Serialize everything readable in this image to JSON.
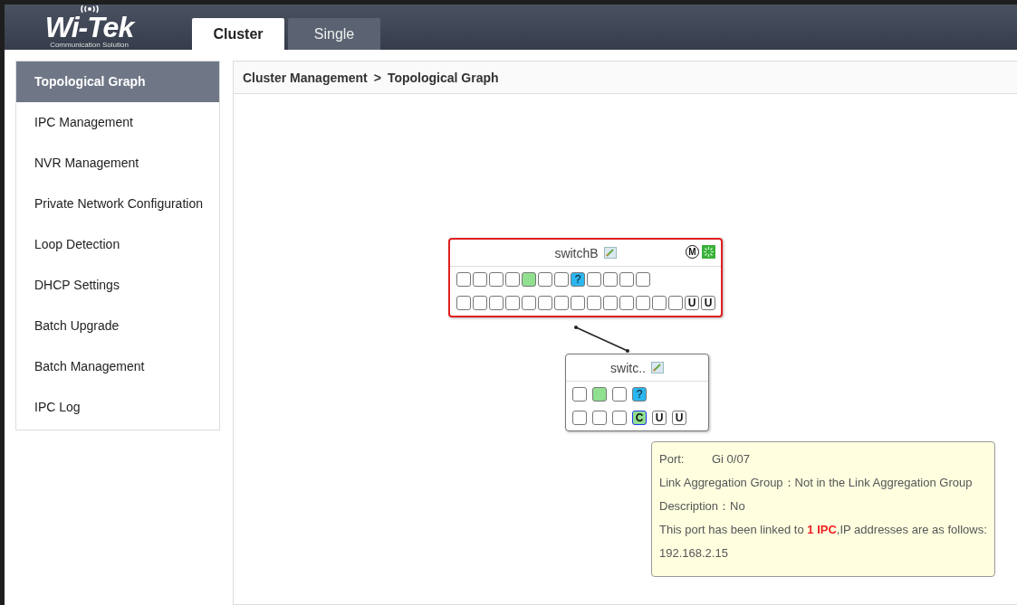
{
  "logo": {
    "name": "Wi-Tek",
    "tagline": "Communication Solution"
  },
  "tabs": [
    {
      "label": "Cluster",
      "selected": true
    },
    {
      "label": "Single",
      "selected": false
    }
  ],
  "sidebar": {
    "items": [
      {
        "label": "Topological Graph",
        "selected": true
      },
      {
        "label": "IPC Management",
        "selected": false
      },
      {
        "label": "NVR Management",
        "selected": false
      },
      {
        "label": "Private Network Configuration",
        "selected": false
      },
      {
        "label": "Loop Detection",
        "selected": false
      },
      {
        "label": "DHCP Settings",
        "selected": false
      },
      {
        "label": "Batch Upgrade",
        "selected": false
      },
      {
        "label": "Batch Management",
        "selected": false
      },
      {
        "label": "IPC Log",
        "selected": false
      }
    ]
  },
  "breadcrumb": {
    "parent": "Cluster Management",
    "separator": ">",
    "current": "Topological Graph"
  },
  "topology": {
    "nodes": [
      {
        "name": "switchB",
        "selected": true,
        "master": true,
        "badge": "M",
        "rows": [
          [
            {
              "kind": "empty"
            },
            {
              "kind": "empty"
            },
            {
              "kind": "empty"
            },
            {
              "kind": "empty"
            },
            {
              "kind": "up"
            },
            {
              "kind": "empty"
            },
            {
              "kind": "empty"
            },
            {
              "kind": "unknown",
              "label": "?"
            },
            {
              "kind": "empty"
            },
            {
              "kind": "empty"
            },
            {
              "kind": "empty"
            },
            {
              "kind": "empty"
            }
          ],
          [
            {
              "kind": "empty"
            },
            {
              "kind": "empty"
            },
            {
              "kind": "empty"
            },
            {
              "kind": "empty"
            },
            {
              "kind": "empty"
            },
            {
              "kind": "empty"
            },
            {
              "kind": "empty"
            },
            {
              "kind": "empty"
            },
            {
              "kind": "empty"
            },
            {
              "kind": "empty"
            },
            {
              "kind": "empty"
            },
            {
              "kind": "empty"
            },
            {
              "kind": "empty"
            },
            {
              "kind": "empty"
            },
            {
              "kind": "uplink",
              "label": "U"
            },
            {
              "kind": "uplink",
              "label": "U"
            }
          ]
        ]
      },
      {
        "name": "switc..",
        "selected": false,
        "master": false,
        "rows": [
          [
            {
              "kind": "empty"
            },
            {
              "kind": "up"
            },
            {
              "kind": "empty"
            },
            {
              "kind": "unknown",
              "label": "?"
            }
          ],
          [
            {
              "kind": "empty"
            },
            {
              "kind": "empty"
            },
            {
              "kind": "empty"
            },
            {
              "kind": "ipc",
              "label": "C"
            },
            {
              "kind": "uplink",
              "label": "U"
            },
            {
              "kind": "uplink",
              "label": "U"
            }
          ]
        ]
      }
    ]
  },
  "tooltip": {
    "lines": [
      {
        "label": "Port:",
        "value": "Gi 0/07"
      },
      {
        "label": "Link Aggregation Group：",
        "value": "Not in the Link Aggregation Group"
      },
      {
        "label": "Description：",
        "value": "No"
      },
      {
        "text": "This port has been linked to **1 IPC**,IP addresses are as follows:"
      },
      {
        "text": "192.168.2.15"
      }
    ]
  }
}
